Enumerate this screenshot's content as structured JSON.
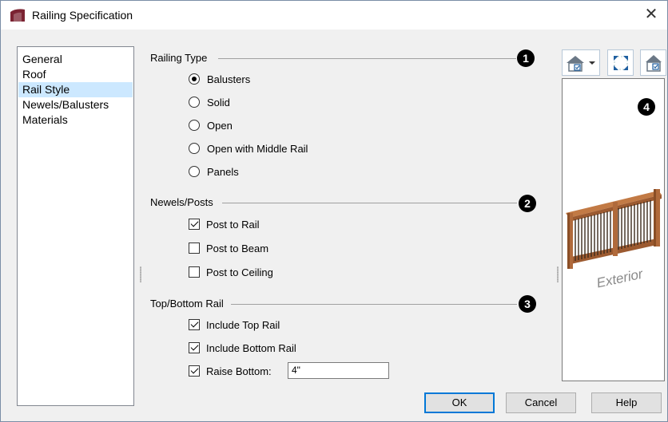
{
  "window": {
    "title": "Railing Specification",
    "close_glyph": "✕",
    "app_icon": "chief-architect-app-icon"
  },
  "nav": {
    "items": [
      {
        "label": "General",
        "selected": false
      },
      {
        "label": "Roof",
        "selected": false
      },
      {
        "label": "Rail Style",
        "selected": true
      },
      {
        "label": "Newels/Balusters",
        "selected": false
      },
      {
        "label": "Materials",
        "selected": false
      }
    ]
  },
  "railing_type": {
    "label": "Railing Type",
    "badge": "1",
    "options": [
      {
        "label": "Balusters",
        "selected": true
      },
      {
        "label": "Solid",
        "selected": false
      },
      {
        "label": "Open",
        "selected": false
      },
      {
        "label": "Open with Middle Rail",
        "selected": false
      },
      {
        "label": "Panels",
        "selected": false
      }
    ]
  },
  "newels_posts": {
    "label": "Newels/Posts",
    "badge": "2",
    "options": [
      {
        "label": "Post to Rail",
        "checked": true
      },
      {
        "label": "Post to Beam",
        "checked": false
      },
      {
        "label": "Post to Ceiling",
        "checked": false
      }
    ]
  },
  "top_bottom_rail": {
    "label": "Top/Bottom Rail",
    "badge": "3",
    "include_top": {
      "label": "Include Top Rail",
      "checked": true
    },
    "include_bottom": {
      "label": "Include Bottom Rail",
      "checked": true
    },
    "raise_bottom": {
      "label": "Raise Bottom:",
      "checked": true,
      "value": "4\""
    }
  },
  "preview": {
    "badge": "4",
    "watermark": "Exterior",
    "toolbar": [
      "camera-view-dropdown-icon",
      "fill-window-icon",
      "color-on-off-icon"
    ]
  },
  "buttons": {
    "ok": "OK",
    "cancel": "Cancel",
    "help": "Help"
  },
  "colors": {
    "selection": "#cce8ff",
    "accent": "#0078d7",
    "rail_wood": "#b06a3b"
  }
}
